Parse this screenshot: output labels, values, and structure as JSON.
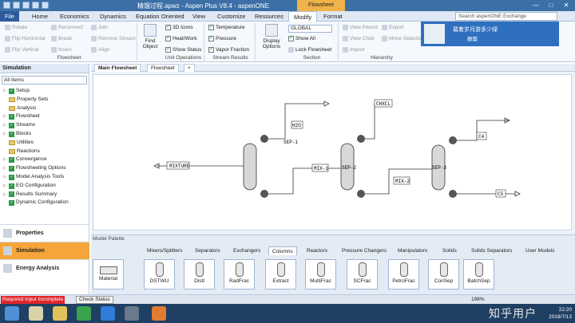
{
  "window": {
    "title": "精馏过程.apwz - Aspen Plus V8.4 - aspenONE",
    "context_tab": "Flowsheet",
    "controls": [
      "—",
      "□",
      "✕"
    ]
  },
  "ribbon_tabs": [
    "File",
    "Home",
    "Economics",
    "Dynamics",
    "Equation Oriented",
    "View",
    "Customize",
    "Resources",
    "Modify",
    "Format"
  ],
  "search_placeholder": "Search aspenONE Exchange",
  "ribbon": {
    "flowsheet_group": {
      "label": "Flowsheet",
      "items": [
        "Rotate",
        "Flip Horizontal",
        "Flip Vertical",
        "Reconnect",
        "Break",
        "Insert",
        "Join",
        "Remove Stream",
        "Align"
      ]
    },
    "find_object": "Find Object",
    "unit_ops_group": {
      "label": "Unit Operations",
      "items": [
        "3D Icons",
        "Heat/Work",
        "Show Status"
      ]
    },
    "stream_results_group": {
      "label": "Stream Results",
      "items": [
        "Temperature",
        "Pressure",
        "Vapor Fraction"
      ]
    },
    "display_options": "Display Options",
    "section_group": {
      "label": "Section",
      "dropdown": "GLOBAL",
      "items": [
        "Show All",
        "Lock Flowsheet"
      ]
    },
    "hierarchy_group": {
      "label": "Hierarchy",
      "items": [
        "View Parent",
        "View Child",
        "Import",
        "Export",
        "Move Selection"
      ]
    }
  },
  "ad": {
    "line1": "载着岁月游多少绿",
    "line2": "静篇"
  },
  "nav_pane": {
    "title": "Simulation",
    "filter": "All Items",
    "tree": [
      {
        "label": "Setup",
        "kind": "check"
      },
      {
        "label": "Property Sets",
        "kind": "folder"
      },
      {
        "label": "Analysis",
        "kind": "folder"
      },
      {
        "label": "Flowsheet",
        "kind": "check"
      },
      {
        "label": "Streams",
        "kind": "check"
      },
      {
        "label": "Blocks",
        "kind": "check"
      },
      {
        "label": "Utilities",
        "kind": "folder"
      },
      {
        "label": "Reactions",
        "kind": "folder"
      },
      {
        "label": "Convergence",
        "kind": "check"
      },
      {
        "label": "Flowsheeting Options",
        "kind": "check"
      },
      {
        "label": "Model Analysis Tools",
        "kind": "check"
      },
      {
        "label": "EO Configuration",
        "kind": "check"
      },
      {
        "label": "Results Summary",
        "kind": "check"
      },
      {
        "label": "Dynamic Configuration",
        "kind": "check"
      }
    ],
    "sections": [
      "Properties",
      "Simulation",
      "Energy Analysis"
    ]
  },
  "doc_tabs": [
    "Main Flowsheet",
    "Flowsheet",
    "+"
  ],
  "flowsheet": {
    "streams": [
      "MIXTURE",
      "H2O",
      "MIX-1",
      "CHXCL",
      "MIX-2",
      "C4",
      "C5"
    ],
    "blocks": [
      "SEP-1",
      "SEP-2",
      "SEP-3"
    ]
  },
  "model_palette": {
    "title": "Model Palette",
    "tabs": [
      "Mixers/Splitters",
      "Separators",
      "Exchangers",
      "Columns",
      "Reactors",
      "Pressure Changers",
      "Manipulators",
      "Solids",
      "Solids Separators",
      "User Models"
    ],
    "active_tab": "Columns",
    "models": [
      "Material",
      "DSTWU",
      "Distl",
      "RadFrac",
      "Extract",
      "MultiFrac",
      "SCFrac",
      "PetroFrac",
      "ConSep",
      "BatchSep"
    ]
  },
  "status": {
    "error": "Required Input Incomplete",
    "check_status": "Check Status",
    "zoom": "198%"
  },
  "taskbar": {
    "time": "22:20",
    "date": "2018/7/13",
    "watermark": "知乎用户"
  }
}
